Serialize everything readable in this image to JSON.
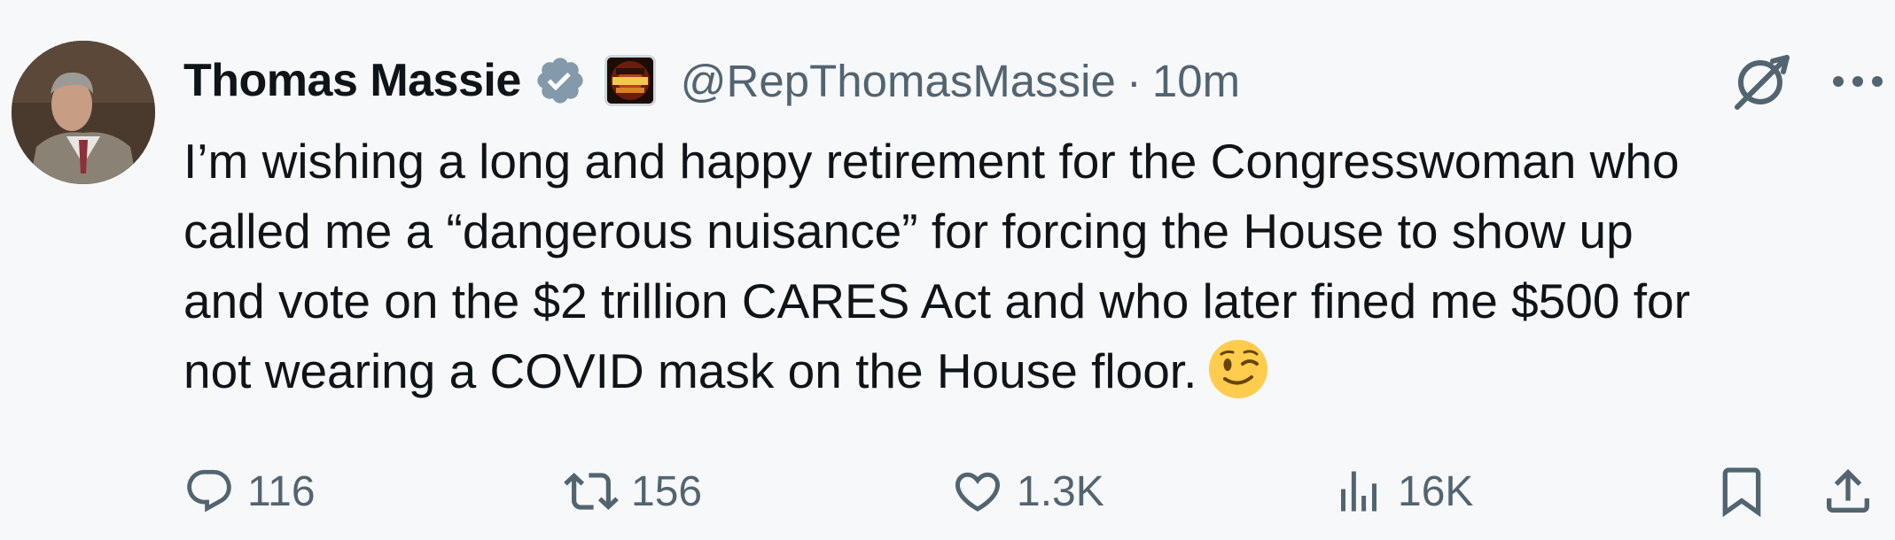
{
  "author": {
    "display_name": "Thomas Massie",
    "handle": "@RepThomasMassie",
    "separator": "·",
    "time": "10m",
    "verified_icon": "verified-badge-icon",
    "affiliation_badge": {
      "icon": "affiliation-badge-icon",
      "text_lines": [
        "THIS IS A",
        "DEMOCRAT",
        "SHUTDOWN"
      ]
    },
    "avatar_icon": "avatar"
  },
  "tweet": {
    "lines": [
      "I’m wishing a long and happy retirement for the Congresswoman who",
      "called me a “dangerous nuisance” for forcing the House to show up",
      "and vote on the $2 trillion CARES Act and who later fined me $500 for",
      "not wearing a COVID mask on the House floor."
    ],
    "emoji": "winking-face-emoji"
  },
  "actions": {
    "reply": {
      "count": "116",
      "icon": "reply-icon"
    },
    "repost": {
      "count": "156",
      "icon": "repost-icon"
    },
    "like": {
      "count": "1.3K",
      "icon": "heart-icon"
    },
    "views": {
      "count": "16K",
      "icon": "views-icon"
    },
    "bookmark": {
      "icon": "bookmark-icon"
    },
    "share": {
      "icon": "share-icon"
    }
  },
  "top_right": {
    "grok_icon": "grok-icon",
    "more_icon": "more-icon"
  },
  "colors": {
    "background": "#f7f8f9",
    "text": "#0f1419",
    "muted": "#536471",
    "verified": "#829aab",
    "emoji": "#ffcc4d"
  }
}
